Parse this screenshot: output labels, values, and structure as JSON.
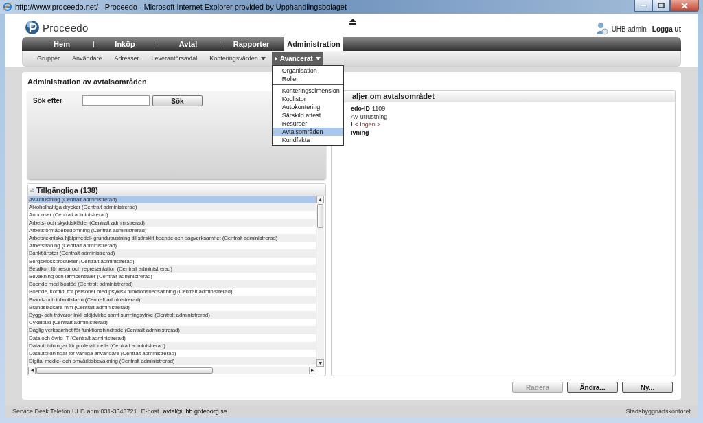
{
  "window": {
    "title": "http://www.proceedo.net/ - Proceedo - Microsoft Internet Explorer provided by Upphandlingsbolaget"
  },
  "header": {
    "logo": "Proceedo",
    "user": "UHB admin",
    "logout": "Logga ut"
  },
  "main_nav": [
    {
      "label": "Hem",
      "selected": false
    },
    {
      "label": "Inköp",
      "selected": false
    },
    {
      "label": "Avtal",
      "selected": false
    },
    {
      "label": "Rapporter",
      "selected": false
    },
    {
      "label": "Administration",
      "selected": true
    }
  ],
  "sub_nav": [
    {
      "label": "Grupper",
      "has_menu": false,
      "selected": false
    },
    {
      "label": "Användare",
      "has_menu": false,
      "selected": false
    },
    {
      "label": "Adresser",
      "has_menu": false,
      "selected": false
    },
    {
      "label": "Leverantörsavtal",
      "has_menu": false,
      "selected": false
    },
    {
      "label": "Konteringsvärden",
      "has_menu": true,
      "selected": false
    },
    {
      "label": "Avancerat",
      "has_menu": true,
      "selected": true
    }
  ],
  "menu": {
    "sections": [
      {
        "items": [
          {
            "label": "Organisation",
            "selected": false
          },
          {
            "label": "Roller",
            "selected": false
          }
        ]
      },
      {
        "items": [
          {
            "label": "Konteringsdimension",
            "selected": false
          },
          {
            "label": "Kodlistor",
            "selected": false
          },
          {
            "label": "Autokontering",
            "selected": false
          },
          {
            "label": "Särskild attest",
            "selected": false
          },
          {
            "label": "Resurser",
            "selected": false
          },
          {
            "label": "Avtalsområden",
            "selected": true
          },
          {
            "label": "Kundfakta",
            "selected": false
          }
        ]
      }
    ]
  },
  "page_title": "Administration av avtalsområden",
  "search": {
    "label": "Sök efter",
    "button": "Sök"
  },
  "list": {
    "title": "Tillgängliga (138)",
    "items": [
      {
        "label": "AV-utrustning (Centralt administrerad)",
        "selected": true
      },
      {
        "label": "Alkoholhaltiga drycker (Centralt administrerad)",
        "selected": false
      },
      {
        "label": "Annonser (Centralt administrerad)",
        "selected": false
      },
      {
        "label": "Arbets- och skyddskläder (Centralt administrerad)",
        "selected": false
      },
      {
        "label": "Arbetsförmågebedömning (Centralt administrerad)",
        "selected": false
      },
      {
        "label": "Arbetstekniska hjälpmedel- grundutrustning till särskilt boende och dagverksamhet (Centralt administrerad)",
        "selected": false
      },
      {
        "label": "Arbetsträning (Centralt administrerad)",
        "selected": false
      },
      {
        "label": "Banktjänster (Centralt administrerad)",
        "selected": false
      },
      {
        "label": "Bergskrossprodukter (Centralt administrerad)",
        "selected": false
      },
      {
        "label": "Betalkort för resor och representation (Centralt administrerad)",
        "selected": false
      },
      {
        "label": "Bevakning och larmcentraler (Centralt administrerad)",
        "selected": false
      },
      {
        "label": "Boende med bostöd (Centralt administrerad)",
        "selected": false
      },
      {
        "label": "Boende, korttid, för personer med psykisk funktionsnedsättning (Centralt administrerad)",
        "selected": false
      },
      {
        "label": "Brand- och inbrottslarm (Centralt administrerad)",
        "selected": false
      },
      {
        "label": "Brandsläckare mm (Centralt administrerad)",
        "selected": false
      },
      {
        "label": "Bygg- och trävaror inkl. slöjdvirke samt surrningsvirke (Centralt administrerad)",
        "selected": false
      },
      {
        "label": "Cykelbud (Centralt administrerad)",
        "selected": false
      },
      {
        "label": "Daglig verksamhet för funktionshindrade (Centralt administrerad)",
        "selected": false
      },
      {
        "label": "Data och övrig IT (Centralt administrerad)",
        "selected": false
      },
      {
        "label": "Datautbildningar för professionella (Centralt administrerad)",
        "selected": false
      },
      {
        "label": "Datautbildningar för vanliga användare (Centralt administrerad)",
        "selected": false
      },
      {
        "label": "Digital medie- och omvärldsbevakning (Centralt administrerad)",
        "selected": false
      }
    ]
  },
  "details": {
    "title": "aljer om avtalsområdet",
    "fields": [
      {
        "label": "edo-ID",
        "value": "1109"
      },
      {
        "value": "AV-utrustning"
      },
      {
        "label": "l",
        "value": "< Ingen >"
      },
      {
        "label": "ivning"
      }
    ]
  },
  "buttons": [
    {
      "label": "Radera",
      "disabled": true
    },
    {
      "label": "Ändra...",
      "disabled": false
    },
    {
      "label": "Ny...",
      "disabled": false
    }
  ],
  "status_bar": {
    "service": "Service Desk Telefon UHB adm:031-3343721",
    "email_label": "E-post",
    "email": "avtal@uhb.goteborg.se",
    "org": "Stadsbyggnadskontoret"
  }
}
